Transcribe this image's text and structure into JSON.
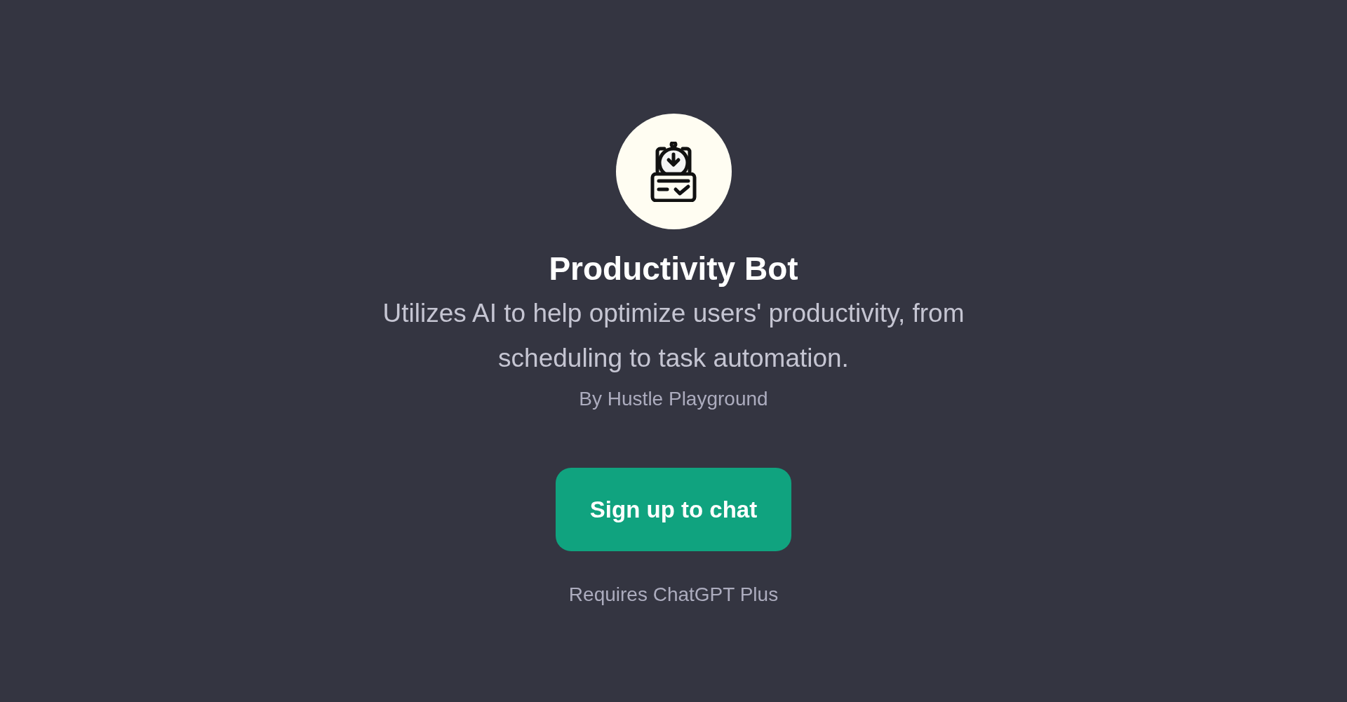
{
  "gpt": {
    "name": "Productivity Bot",
    "description": "Utilizes AI to help optimize users' productivity, from scheduling to task automation.",
    "author": "By Hustle Playground"
  },
  "signup_button": {
    "label": "Sign up to chat"
  },
  "footnote": "Requires ChatGPT Plus"
}
